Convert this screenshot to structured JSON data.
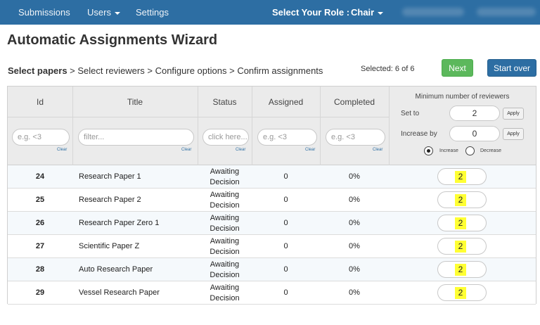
{
  "nav": {
    "submissions": "Submissions",
    "users": "Users",
    "settings": "Settings",
    "role_label": "Select Your Role :",
    "role_value": "Chair"
  },
  "page_title": "Automatic Assignments Wizard",
  "steps": {
    "step1": "Select papers",
    "sep": " > ",
    "step2": "Select reviewers",
    "step3": "Configure options",
    "step4": "Confirm assignments"
  },
  "selected_text": "Selected: 6 of 6",
  "buttons": {
    "next": "Next",
    "start_over": "Start over"
  },
  "table": {
    "headers": {
      "id": "Id",
      "title": "Title",
      "status": "Status",
      "assigned": "Assigned",
      "completed": "Completed",
      "min_reviewers": "Minimum number of reviewers"
    },
    "filters": {
      "id_placeholder": "e.g. <3",
      "title_placeholder": "filter...",
      "status_placeholder": "click here...",
      "assigned_placeholder": "e.g. <3",
      "completed_placeholder": "e.g. <3",
      "clear": "Clear"
    },
    "min_options": {
      "set_to_label": "Set to",
      "set_to_value": "2",
      "increase_by_label": "Increase by",
      "increase_by_value": "0",
      "apply": "Apply",
      "increase": "Increase",
      "decrease": "Decrease",
      "selected_mode": "Increase"
    },
    "rows": [
      {
        "id": "24",
        "title": "Research Paper 1",
        "status": "Awaiting Decision",
        "assigned": "0",
        "completed": "0%",
        "min": "2"
      },
      {
        "id": "25",
        "title": "Research Paper 2",
        "status": "Awaiting Decision",
        "assigned": "0",
        "completed": "0%",
        "min": "2"
      },
      {
        "id": "26",
        "title": "Research Paper Zero 1",
        "status": "Awaiting Decision",
        "assigned": "0",
        "completed": "0%",
        "min": "2"
      },
      {
        "id": "27",
        "title": "Scientific Paper Z",
        "status": "Awaiting Decision",
        "assigned": "0",
        "completed": "0%",
        "min": "2"
      },
      {
        "id": "28",
        "title": "Auto Research Paper",
        "status": "Awaiting Decision",
        "assigned": "0",
        "completed": "0%",
        "min": "2"
      },
      {
        "id": "29",
        "title": "Vessel Research Paper",
        "status": "Awaiting Decision",
        "assigned": "0",
        "completed": "0%",
        "min": "2"
      }
    ]
  },
  "colors": {
    "navbar": "#2d6ea3",
    "next_button": "#5cb85c",
    "start_over_button": "#2d6ea3",
    "highlight": "#ffff33"
  }
}
